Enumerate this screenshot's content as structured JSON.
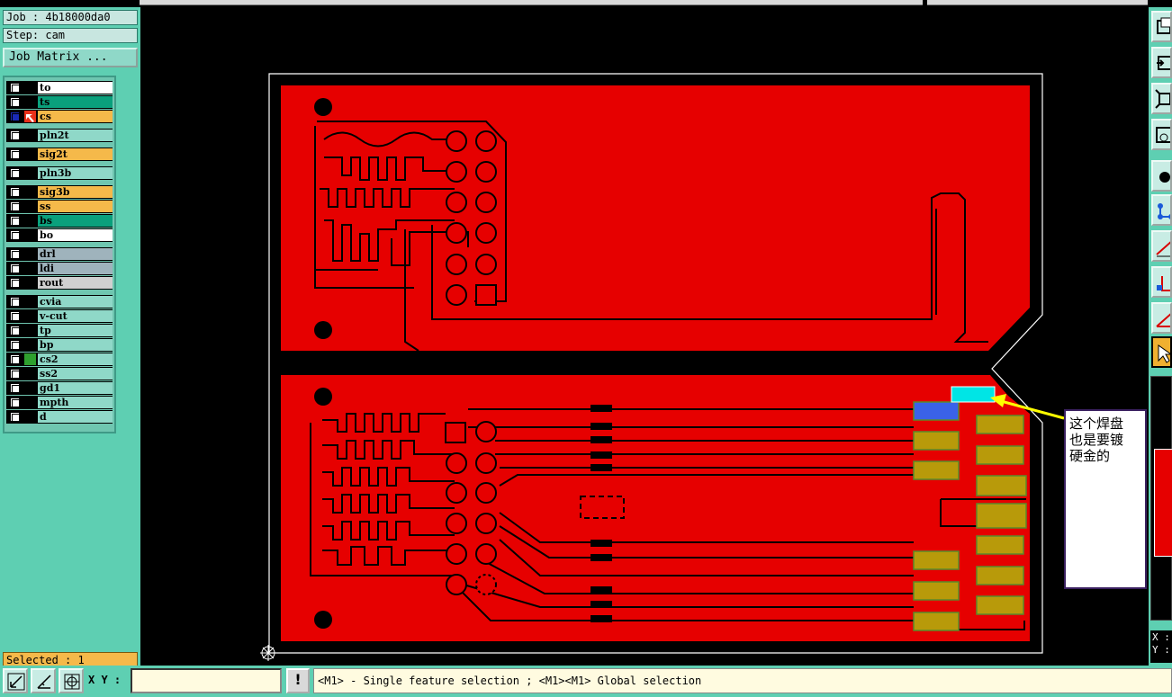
{
  "job": "Job : 4b18000da0",
  "step": "Step: cam",
  "job_matrix_label": "Job Matrix ...",
  "selected": "Selected : 1",
  "layers": [
    {
      "name": "to",
      "color": "#ffffff",
      "group": 0
    },
    {
      "name": "ts",
      "color": "#0aa07c",
      "group": 0
    },
    {
      "name": "cs",
      "color": "#f5b94a",
      "group": 0,
      "active": true
    },
    {
      "name": "pln2t",
      "color": "#8fd8c8",
      "group": 1
    },
    {
      "name": "sig2t",
      "color": "#f5b94a",
      "group": 2
    },
    {
      "name": "pln3b",
      "color": "#8fd8c8",
      "group": 3
    },
    {
      "name": "sig3b",
      "color": "#f5b94a",
      "group": 4
    },
    {
      "name": "ss",
      "color": "#f5b94a",
      "group": 4
    },
    {
      "name": "bs",
      "color": "#0aa07c",
      "group": 4
    },
    {
      "name": "bo",
      "color": "#ffffff",
      "group": 4
    },
    {
      "name": "drl",
      "color": "#9fb3bc",
      "group": 5
    },
    {
      "name": "ldi",
      "color": "#9fb3bc",
      "group": 5
    },
    {
      "name": "rout",
      "color": "#d0d0d0",
      "group": 5
    },
    {
      "name": "cvia",
      "color": "#8fd8c8",
      "group": 6
    },
    {
      "name": "v-cut",
      "color": "#8fd8c8",
      "group": 6
    },
    {
      "name": "tp",
      "color": "#8fd8c8",
      "group": 6
    },
    {
      "name": "bp",
      "color": "#8fd8c8",
      "group": 6
    },
    {
      "name": "cs2",
      "color": "#8fd8c8",
      "group": 6,
      "indicator": "#2ea02e"
    },
    {
      "name": "ss2",
      "color": "#8fd8c8",
      "group": 6
    },
    {
      "name": "gd1",
      "color": "#8fd8c8",
      "group": 6
    },
    {
      "name": "mpth",
      "color": "#8fd8c8",
      "group": 6
    },
    {
      "name": "d",
      "color": "#8fd8c8",
      "group": 6
    }
  ],
  "annotation": "这个焊盘\n也是要镀\n硬金的",
  "xy_label": "X Y :",
  "xy_value": "",
  "warn_label": "!",
  "hint": "<M1> - Single feature selection ; <M1><M1> Global selection",
  "xy_readout": {
    "x": "X :",
    "y": "Y :"
  },
  "tools": [
    "zoom-window-icon",
    "zoom-in-icon",
    "zoom-fit-icon",
    "snap-icon",
    "select-point-icon",
    "net-icon",
    "line-icon",
    "measure-icon",
    "angle-icon",
    "pointer-icon"
  ],
  "colors": {
    "panel": "#5ecfb2",
    "copper": "#e60000",
    "pad": "#b89a0a",
    "selected_pad": "#00e5e5",
    "blue_pad": "#3a62e8",
    "arrow": "#ffff00"
  }
}
